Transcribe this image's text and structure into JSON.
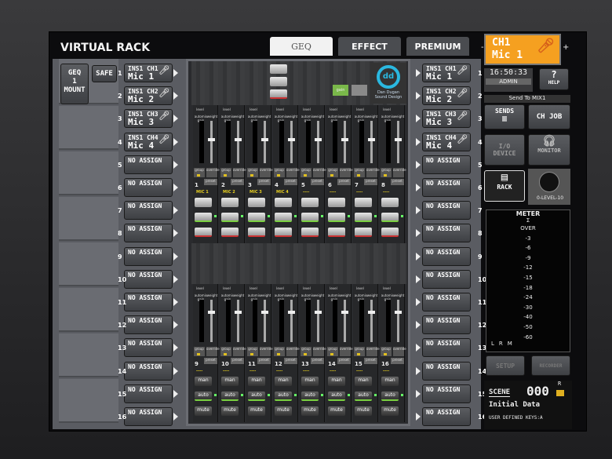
{
  "header": {
    "title": "VIRTUAL RACK",
    "tabs": [
      {
        "label": "GEQ",
        "active": true
      },
      {
        "label": "EFFECT",
        "active": false
      },
      {
        "label": "PREMIUM",
        "active": false
      }
    ]
  },
  "rack_slots": {
    "mount_label": [
      "GEQ",
      "1",
      "MOUNT"
    ],
    "safe_label": "SAFE"
  },
  "inputs": [
    {
      "line1": "INS1 CH1",
      "line2": "Mic 1",
      "mic": true
    },
    {
      "line1": "INS1 CH2",
      "line2": "Mic 2",
      "mic": true
    },
    {
      "line1": "INS1 CH3",
      "line2": "Mic 3",
      "mic": true
    },
    {
      "line1": "INS1 CH4",
      "line2": "Mic 4",
      "mic": true
    },
    {
      "line1": "NO ASSIGN",
      "line2": ""
    },
    {
      "line1": "NO ASSIGN",
      "line2": ""
    },
    {
      "line1": "NO ASSIGN",
      "line2": ""
    },
    {
      "line1": "NO ASSIGN",
      "line2": ""
    },
    {
      "line1": "NO ASSIGN",
      "line2": ""
    },
    {
      "line1": "NO ASSIGN",
      "line2": ""
    },
    {
      "line1": "NO ASSIGN",
      "line2": ""
    },
    {
      "line1": "NO ASSIGN",
      "line2": ""
    },
    {
      "line1": "NO ASSIGN",
      "line2": ""
    },
    {
      "line1": "NO ASSIGN",
      "line2": ""
    },
    {
      "line1": "NO ASSIGN",
      "line2": ""
    },
    {
      "line1": "NO ASSIGN",
      "line2": ""
    }
  ],
  "plugin": {
    "logo_text": [
      "Dan Dugan",
      "Sound Design"
    ],
    "top_buttons": [
      "gain",
      ""
    ],
    "strip_labels": {
      "level": "level",
      "gain": "automix gain",
      "weight": "weight",
      "group": "group",
      "override": "override",
      "preset": "preset"
    },
    "channels": [
      {
        "num": "1",
        "name": "MIC 1"
      },
      {
        "num": "2",
        "name": "MIC 2"
      },
      {
        "num": "3",
        "name": "MIC 3"
      },
      {
        "num": "4",
        "name": "MIC 4"
      },
      {
        "num": "5",
        "name": "----"
      },
      {
        "num": "6",
        "name": "----"
      },
      {
        "num": "7",
        "name": "----"
      },
      {
        "num": "8",
        "name": "----"
      },
      {
        "num": "9",
        "name": "----"
      },
      {
        "num": "10",
        "name": "----"
      },
      {
        "num": "11",
        "name": "----"
      },
      {
        "num": "12",
        "name": "----"
      },
      {
        "num": "13",
        "name": "----"
      },
      {
        "num": "14",
        "name": "----"
      },
      {
        "num": "15",
        "name": "----"
      },
      {
        "num": "16",
        "name": "----"
      }
    ],
    "mode_buttons": [
      "man",
      "auto",
      "mute"
    ]
  },
  "right_panel": {
    "channel": {
      "line1": "CH1",
      "line2": "Mic 1",
      "accent": "#f5a020"
    },
    "time": "16:50:33",
    "user": "ADMIN",
    "help": "HELP",
    "send_to": "Send To MIX1",
    "sends": "SENDS",
    "ch_job": "CH JOB",
    "io_device": [
      "I/O",
      "DEVICE"
    ],
    "monitor": "MONITOR",
    "rack": "RACK",
    "level": {
      "min": "0",
      "label": "LEVEL",
      "max": "10"
    },
    "meter": {
      "title": "METER",
      "scale": [
        "OVER",
        "-3",
        "-6",
        "-9",
        "-12",
        "-15",
        "-18",
        "-24",
        "-30",
        "-40",
        "-50",
        "-60"
      ],
      "channels": [
        "L",
        "R",
        "M"
      ]
    },
    "setup": "SETUP",
    "recorder": "RECORDER",
    "scene": {
      "label": "SCENE",
      "number": "000",
      "flag": "R",
      "name": "Initial Data"
    },
    "user_keys": "USER DEFINED KEYS:A"
  }
}
